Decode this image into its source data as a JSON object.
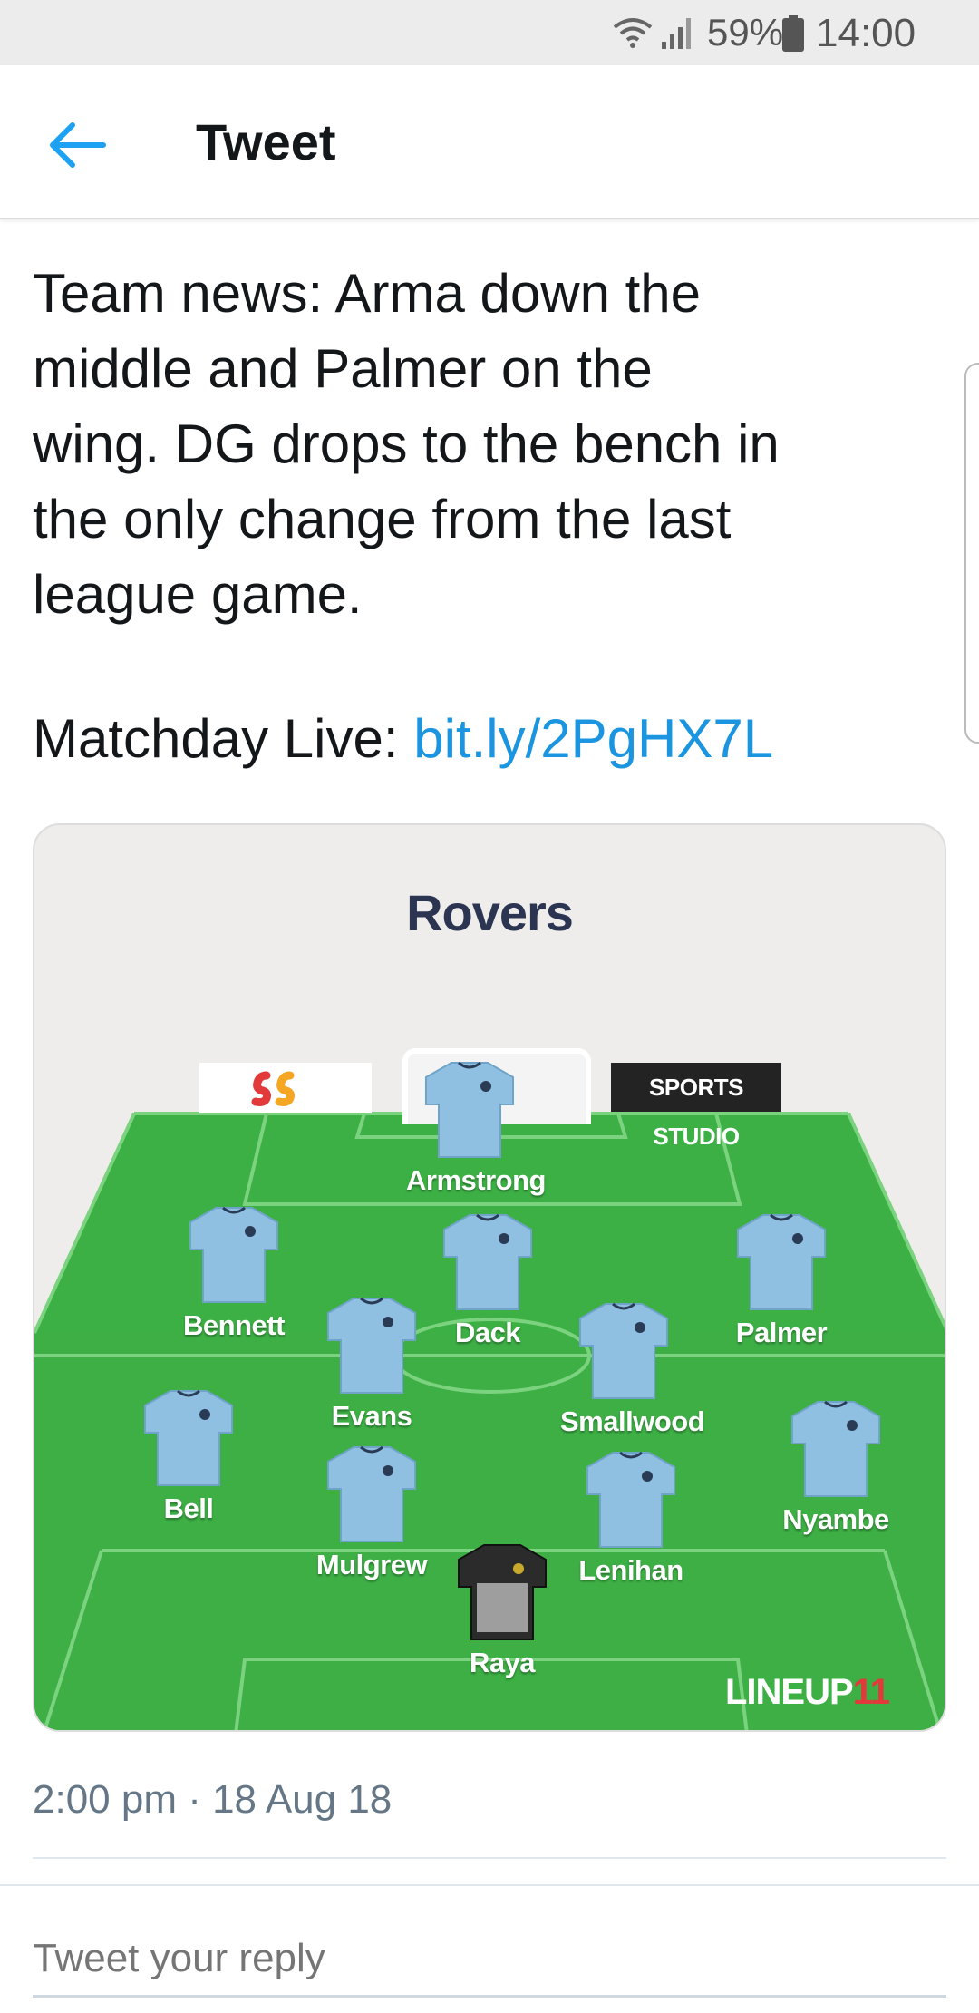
{
  "status_bar": {
    "battery": "59%",
    "time": "14:00",
    "icons": [
      "wifi-icon",
      "signal-icon",
      "battery-icon"
    ]
  },
  "app_bar": {
    "back_icon": "back-arrow-icon",
    "title": "Tweet"
  },
  "tweet": {
    "text": "Team news: Arma down the\nmiddle and Palmer on the\nwing. DG drops to the bench in\nthe only change from the last\nleague game.",
    "matchday_label": "Matchday Live: ",
    "link": "bit.ly/2PgHX7L",
    "timestamp": "2:00 pm · 18 Aug 18"
  },
  "lineup_image": {
    "team": "Rovers",
    "sponsor_left": "SS",
    "sponsor_right": "SPORTS STUDIO",
    "watermark_main": "LINEUP",
    "watermark_num": "11",
    "players": [
      {
        "name": "Armstrong",
        "kit": "outfield"
      },
      {
        "name": "Bennett",
        "kit": "outfield"
      },
      {
        "name": "Dack",
        "kit": "outfield"
      },
      {
        "name": "Palmer",
        "kit": "outfield"
      },
      {
        "name": "Evans",
        "kit": "outfield"
      },
      {
        "name": "Smallwood",
        "kit": "outfield"
      },
      {
        "name": "Bell",
        "kit": "outfield"
      },
      {
        "name": "Nyambe",
        "kit": "outfield"
      },
      {
        "name": "Mulgrew",
        "kit": "outfield"
      },
      {
        "name": "Lenihan",
        "kit": "outfield"
      },
      {
        "name": "Raya",
        "kit": "goalkeeper"
      }
    ],
    "colors": {
      "pitch": "#3cb044",
      "shirt": "#8fc0e2",
      "goalkeeper_shirt": "#2b2b2b",
      "team_name": "#2b3450"
    }
  },
  "reply": {
    "placeholder": "Tweet your reply"
  },
  "colors": {
    "link": "#1b95e0",
    "accent": "#1da1f2",
    "muted_text": "#657786"
  }
}
